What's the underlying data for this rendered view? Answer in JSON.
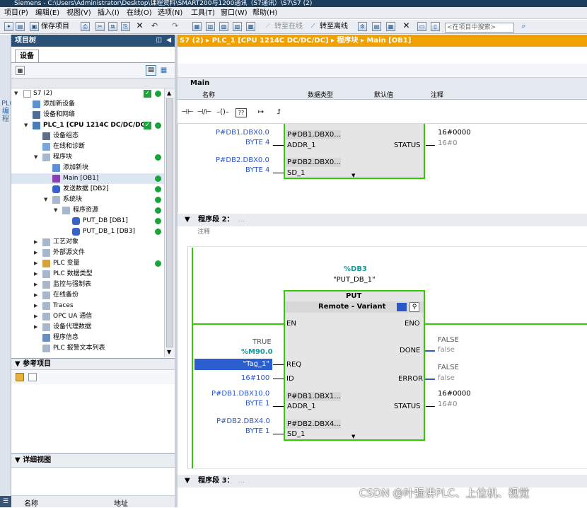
{
  "window": {
    "title": "Siemens - C:\\Users\\Administrator\\Desktop\\课程资料\\SMART200与1200通讯（S7通讯）\\S7\\S7 (2)"
  },
  "menu": [
    "项目(P)",
    "编辑(E)",
    "视图(V)",
    "插入(I)",
    "在线(O)",
    "选项(N)",
    "工具(T)",
    "窗口(W)",
    "帮助(H)"
  ],
  "toolbar": {
    "save_project": "保存项目",
    "go_online": "转至在线",
    "go_offline": "转至离线",
    "search_placeholder": "<在项目中搜索>"
  },
  "side_strip": {
    "label": "PLC 编程"
  },
  "project_tree": {
    "title": "项目树",
    "devices_tab": "设备",
    "items": [
      {
        "label": "S7 (2)"
      },
      {
        "label": "添加新设备"
      },
      {
        "label": "设备和网络"
      },
      {
        "label": "PLC_1 [CPU 1214C DC/DC/DC]"
      },
      {
        "label": "设备组态"
      },
      {
        "label": "在线和诊断"
      },
      {
        "label": "程序块"
      },
      {
        "label": "添加新块"
      },
      {
        "label": "Main [OB1]"
      },
      {
        "label": "发送数据 [DB2]"
      },
      {
        "label": "系统块"
      },
      {
        "label": "程序资源"
      },
      {
        "label": "PUT_DB [DB1]"
      },
      {
        "label": "PUT_DB_1 [DB3]"
      },
      {
        "label": "工艺对象"
      },
      {
        "label": "外部源文件"
      },
      {
        "label": "PLC 变量"
      },
      {
        "label": "PLC 数据类型"
      },
      {
        "label": "监控与强制表"
      },
      {
        "label": "在线备份"
      },
      {
        "label": "Traces"
      },
      {
        "label": "OPC UA 通信"
      },
      {
        "label": "设备代理数据"
      },
      {
        "label": "程序信息"
      },
      {
        "label": "PLC 报警文本列表"
      }
    ]
  },
  "reference_projects": {
    "title": "参考项目"
  },
  "detail_view": {
    "title": "详细视图",
    "columns": [
      "名称",
      "地址"
    ]
  },
  "editor": {
    "breadcrumb": "S7 (2)  ▸ PLC_1 [CPU 1214C DC/DC/DC]  ▸ 程序块  ▸ Main [OB1]",
    "interface": {
      "block": "Main",
      "columns": [
        "名称",
        "数据类型",
        "默认值",
        "注释"
      ]
    },
    "ladder_buttons": [
      "⊣⊢",
      "⊣/⊢",
      "–()–",
      "??",
      "↦",
      "⮥"
    ],
    "network1": {
      "addr1_actual": "P#DB1.DBX0.0",
      "addr1_len": "BYTE 4",
      "addr1_param": "P#DB1.DBX0....",
      "sd1_actual": "P#DB2.DBX0.0",
      "sd1_len": "BYTE 4",
      "sd1_param": "P#DB2.DBX0....",
      "status_value": "16#0000",
      "status_live": "16#0"
    },
    "network2": {
      "title": "程序段 2：",
      "comment": "注释",
      "instance_db": "%DB3",
      "instance_name": "\"PUT_DB_1\"",
      "block_name": "PUT",
      "block_mode": "Remote  -  Variant",
      "en": "EN",
      "eno": "ENO",
      "req_value": "TRUE",
      "req_operand": "%M90.0",
      "req_tag": "\"Tag_1\"",
      "id_value": "16#100",
      "done_value": "FALSE",
      "done_live": "false",
      "error_value": "FALSE",
      "error_live": "false",
      "status_value": "16#0000",
      "status_live": "16#0",
      "addr1_actual": "P#DB1.DBX10.0",
      "addr1_len": "BYTE 1",
      "addr1_param": "P#DB1.DBX1...",
      "sd1_actual": "P#DB2.DBX4.0",
      "sd1_len": "BYTE 1",
      "sd1_param": "P#DB2.DBX4...."
    },
    "network3": {
      "title": "程序段 3："
    },
    "pins": {
      "req": "REQ",
      "id": "ID",
      "addr1": "ADDR_1",
      "sd1": "SD_1",
      "done": "DONE",
      "error": "ERROR",
      "status": "STATUS"
    }
  },
  "watermark": "CSDN @叶强讲PLC、上位机、视觉",
  "colors": {
    "accent_orange": "#f0a100",
    "ok_green": "#1aa53a",
    "power_flow": "#33cc00"
  }
}
